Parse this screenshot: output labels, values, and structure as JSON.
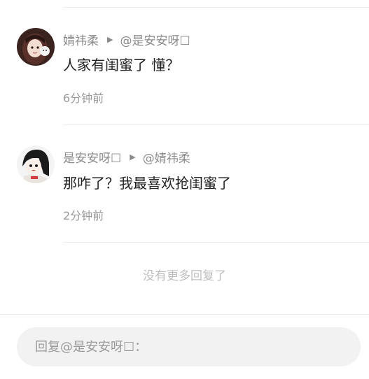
{
  "comments": [
    {
      "author": "婧祎柔",
      "reply_to": "@是安安呀☐",
      "text": "人家有闺蜜了  懂？",
      "time": "6分钟前"
    },
    {
      "author": "是安安呀☐",
      "reply_to": "@婧祎柔",
      "text": "那咋了？我最喜欢抢闺蜜了",
      "time": "2分钟前"
    }
  ],
  "no_more_label": "没有更多回复了",
  "reply_box": {
    "placeholder": "回复@是安安呀☐："
  },
  "colors": {
    "divider": "#ececec",
    "meta_text": "#8a8a8a",
    "body_text": "#222222",
    "reply_bg": "#f2f2f2"
  }
}
